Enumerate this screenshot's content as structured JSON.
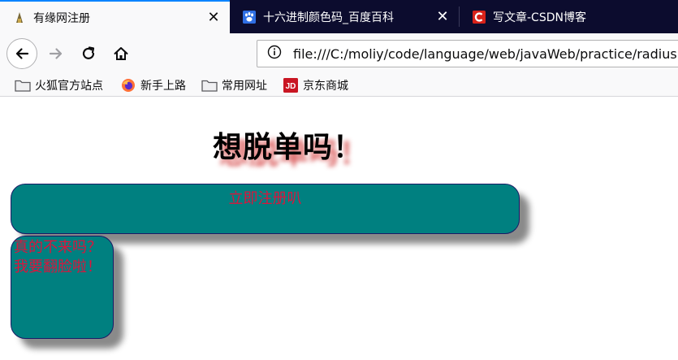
{
  "tabs": [
    {
      "title": "有缘网注册",
      "active": true,
      "icon": "site-favicon"
    },
    {
      "title": "十六进制颜色码_百度百科",
      "active": false,
      "icon": "baidu-paw-icon"
    },
    {
      "title": "写文章-CSDN博客",
      "active": false,
      "icon": "csdn-c-icon"
    }
  ],
  "tab_close_glyph": "✕",
  "urlbar": {
    "url": "file:///C:/moliy/code/language/web/javaWeb/practice/radius.html"
  },
  "bookmarks": [
    {
      "label": "火狐官方站点",
      "icon": "folder-icon"
    },
    {
      "label": "新手上路",
      "icon": "firefox-icon"
    },
    {
      "label": "常用网址",
      "icon": "folder-icon"
    },
    {
      "label": "京东商城",
      "icon": "jd-icon"
    }
  ],
  "page": {
    "heading": "想脱单吗！",
    "register_button": "立即注册叭",
    "angry_line1": "真的不来吗？",
    "angry_line2": "我要翻脸啦！"
  },
  "colors": {
    "tabstrip": "#0c0c2e",
    "accent": "#0a84ff",
    "box_fill": "#008080",
    "box_text": "#dc143c",
    "heading_shadow": "#cd2828"
  }
}
